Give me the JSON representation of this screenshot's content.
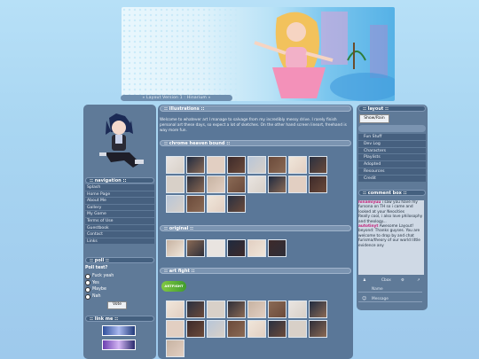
{
  "header": {
    "caption": "» Layout Version 1 : Hinarium «"
  },
  "left": {
    "nav_title": ":: navigation ::",
    "nav_items": [
      "Splash",
      "Home Page",
      "About Me",
      "Gallery",
      "My Game",
      "Terms of Use",
      "Guestbook",
      "Contact",
      "Links"
    ],
    "poll_title": ":: poll ::",
    "poll_question": "Poll test?",
    "poll_options": [
      "Fuck yeah",
      "Yes",
      "Maybe",
      "Nah"
    ],
    "vote_label": "Vote",
    "link_title": ":: link me ::"
  },
  "center": {
    "section1_title": ":: illustrations ::",
    "intro": "Welcome to whatever art I manage to salvage from my incredibly messy drive. I rarely finish personal art these days, so expect a lot of sketches. On the other hand screen lineart, freehand is way more fun.",
    "section2_title": ":: chrome heaven bound ::",
    "section3_title": ":: original ::",
    "section4_title": ":: art fight ::",
    "artfight_badge": "ARTFIGHT"
  },
  "right": {
    "layout_title": ":: layout ::",
    "layout_button": "Show/Rain",
    "menu_items": [
      "Fun Stuff",
      "Dev Log",
      "Characters",
      "Playlists",
      "Adopted",
      "Resources",
      "Credit"
    ],
    "comment_title": ":: comment box ::",
    "comments": [
      {
        "name": "hinamiyuu",
        "text": "i saw you have my fursona on TH so i came and looked at your Neocities"
      },
      {
        "name": "",
        "text": "Really cool, i also love philosophy and theology..."
      },
      {
        "name": "autotinyt",
        "text": "Awesome Layout!"
      },
      {
        "name": "",
        "text": "beyond: Thanks guyses. You are welcome to drop by and chat furisma/theory of our world little evidence any"
      }
    ],
    "cbox_label": "Cbox",
    "name_placeholder": "Name",
    "message_placeholder": "Message"
  },
  "colors": {
    "panel": "#5f7a98",
    "bar": "#7b94b1",
    "item": "#46607f",
    "page_bg": "#a9d6f2"
  }
}
